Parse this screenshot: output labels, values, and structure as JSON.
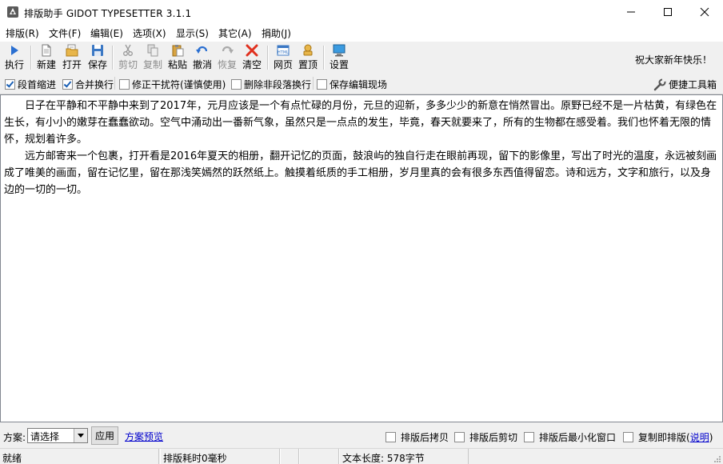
{
  "window": {
    "title": "排版助手 GIDOT TYPESETTER 3.1.1"
  },
  "menu": [
    "排版(R)",
    "文件(F)",
    "编辑(E)",
    "选项(X)",
    "显示(S)",
    "其它(A)",
    "捐助(J)"
  ],
  "toolbar": {
    "run": "执行",
    "new": "新建",
    "open": "打开",
    "save": "保存",
    "cut": "剪切",
    "copy": "复制",
    "paste": "粘贴",
    "undo": "撤消",
    "redo": "恢复",
    "clear": "清空",
    "web": "网页",
    "top": "置顶",
    "settings": "设置",
    "greeting": "祝大家新年快乐！"
  },
  "options": {
    "indent": "段首缩进",
    "merge": "合并换行",
    "fix": "修正干扰符(谨慎使用)",
    "delete_breaks": "删除非段落换行",
    "keep_scene": "保存编辑现场",
    "tools": "便捷工具箱",
    "indent_checked": true,
    "merge_checked": true,
    "fix_checked": false,
    "delete_breaks_checked": false,
    "keep_scene_checked": false
  },
  "editor": {
    "paragraphs": [
      "日子在平静和不平静中来到了2017年，元月应该是一个有点忙碌的月份，元旦的迎新，多多少少的新意在悄然冒出。原野已经不是一片枯黄，有绿色在生长，有小小的嫩芽在蠢蠢欲动。空气中涌动出一番新气象，虽然只是一点点的发生，毕竟，春天就要来了，所有的生物都在感受着。我们也怀着无限的情怀，规划着许多。",
      "远方邮寄来一个包裹，打开看是2016年夏天的相册，翻开记忆的页面，鼓浪屿的独自行走在眼前再现，留下的影像里，写出了时光的温度，永远被刻画成了唯美的画面，留在记忆里，留在那浅笑嫣然的跃然纸上。触摸着纸质的手工相册，岁月里真的会有很多东西值得留恋。诗和远方，文字和旅行，以及身边的一切的一切。"
    ]
  },
  "bottom": {
    "scheme_label": "方案:",
    "scheme_value": "请选择",
    "apply": "应用",
    "preview": "方案预览",
    "copy_after": "排版后拷贝",
    "cut_after": "排版后剪切",
    "minimize_after": "排版后最小化窗口",
    "copy_then_format": "复制即排版(",
    "help": "说明",
    "close_paren": ")"
  },
  "status": {
    "ready": "就绪",
    "time": "排版耗时0毫秒",
    "length": "文本长度: 578字节"
  },
  "colors": {
    "accent": "#1a5fb4",
    "link": "#0000cc",
    "chrome": "#f0f0f0"
  }
}
